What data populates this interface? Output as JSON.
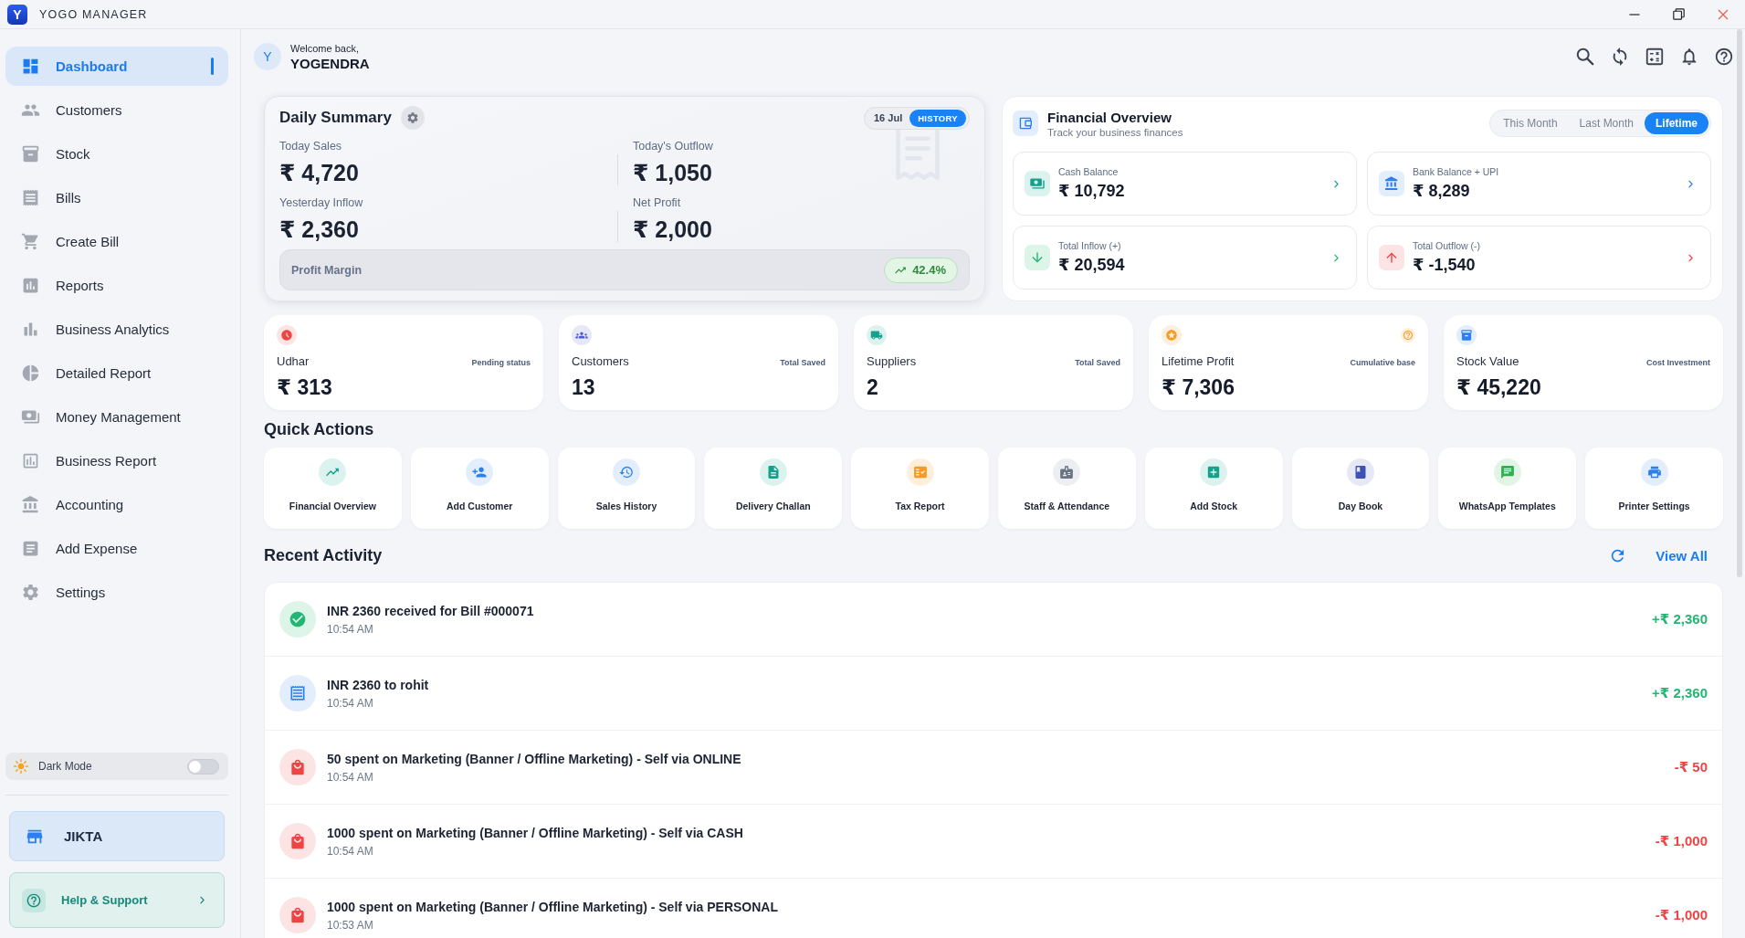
{
  "window": {
    "logo": "Y",
    "title": "YOGO MANAGER"
  },
  "sidebar": {
    "items": [
      {
        "label": "Dashboard",
        "selected": true
      },
      {
        "label": "Customers",
        "selected": false
      },
      {
        "label": "Stock",
        "selected": false
      },
      {
        "label": "Bills",
        "selected": false
      },
      {
        "label": "Create Bill",
        "selected": false
      },
      {
        "label": "Reports",
        "selected": false
      },
      {
        "label": "Business Analytics",
        "selected": false
      },
      {
        "label": "Detailed Report",
        "selected": false
      },
      {
        "label": "Money Management",
        "selected": false
      },
      {
        "label": "Business Report",
        "selected": false
      },
      {
        "label": "Accounting",
        "selected": false
      },
      {
        "label": "Add Expense",
        "selected": false
      },
      {
        "label": "Settings",
        "selected": false
      }
    ],
    "dark_mode": {
      "label": "Dark Mode",
      "on": false
    },
    "shop": {
      "name": "JIKTA"
    },
    "help": {
      "label": "Help & Support"
    }
  },
  "header": {
    "avatar": "Y",
    "greeting": "Welcome back,",
    "user": "YOGENDRA"
  },
  "daily_summary": {
    "title": "Daily Summary",
    "date": "16 Jul",
    "history": "HISTORY",
    "metrics": [
      {
        "label": "Today Sales",
        "value": "₹ 4,720"
      },
      {
        "label": "Today's Outflow",
        "value": "₹ 1,050"
      },
      {
        "label": "Yesterday Inflow",
        "value": "₹ 2,360"
      },
      {
        "label": "Net Profit",
        "value": "₹ 2,000"
      }
    ],
    "profit_margin": {
      "label": "Profit Margin",
      "value": "42.4%"
    }
  },
  "financial_overview": {
    "title": "Financial Overview",
    "subtitle": "Track your business finances",
    "tabs": [
      {
        "label": "This Month",
        "selected": false
      },
      {
        "label": "Last Month",
        "selected": false
      },
      {
        "label": "Lifetime",
        "selected": true
      }
    ],
    "cards": [
      {
        "label": "Cash Balance",
        "value": "₹ 10,792"
      },
      {
        "label": "Bank Balance + UPI",
        "value": "₹ 8,289"
      },
      {
        "label": "Total Inflow (+)",
        "value": "₹ 20,594"
      },
      {
        "label": "Total Outflow (-)",
        "value": "₹ -1,540"
      }
    ]
  },
  "stats": [
    {
      "label": "Udhar",
      "note": "Pending status",
      "value": "₹ 313"
    },
    {
      "label": "Customers",
      "note": "Total Saved",
      "value": "13"
    },
    {
      "label": "Suppliers",
      "note": "Total Saved",
      "value": "2"
    },
    {
      "label": "Lifetime Profit",
      "note": "Cumulative base",
      "value": "₹ 7,306"
    },
    {
      "label": "Stock Value",
      "note": "Cost Investment",
      "value": "₹ 45,220"
    }
  ],
  "quick_actions": {
    "title": "Quick Actions",
    "items": [
      "Financial Overview",
      "Add Customer",
      "Sales History",
      "Delivery Challan",
      "Tax Report",
      "Staff & Attendance",
      "Add Stock",
      "Day Book",
      "WhatsApp Templates",
      "Printer Settings"
    ]
  },
  "recent_activity": {
    "title": "Recent Activity",
    "view_all": "View All",
    "items": [
      {
        "kind": "payment",
        "title": "INR 2360 received for Bill #000071",
        "time": "10:54 AM",
        "amount": "+₹ 2,360"
      },
      {
        "kind": "bill",
        "title": "INR 2360 to rohit",
        "time": "10:54 AM",
        "amount": "+₹ 2,360"
      },
      {
        "kind": "expense",
        "title": "50 spent on Marketing (Banner / Offline Marketing) - Self via ONLINE",
        "time": "10:54 AM",
        "amount": "-₹ 50"
      },
      {
        "kind": "expense",
        "title": "1000 spent on Marketing (Banner / Offline Marketing) - Self via CASH",
        "time": "10:54 AM",
        "amount": "-₹ 1,000"
      },
      {
        "kind": "expense",
        "title": "1000 spent on Marketing (Banner / Offline Marketing) - Self via PERSONAL",
        "time": "10:53 AM",
        "amount": "-₹ 1,000"
      }
    ]
  }
}
